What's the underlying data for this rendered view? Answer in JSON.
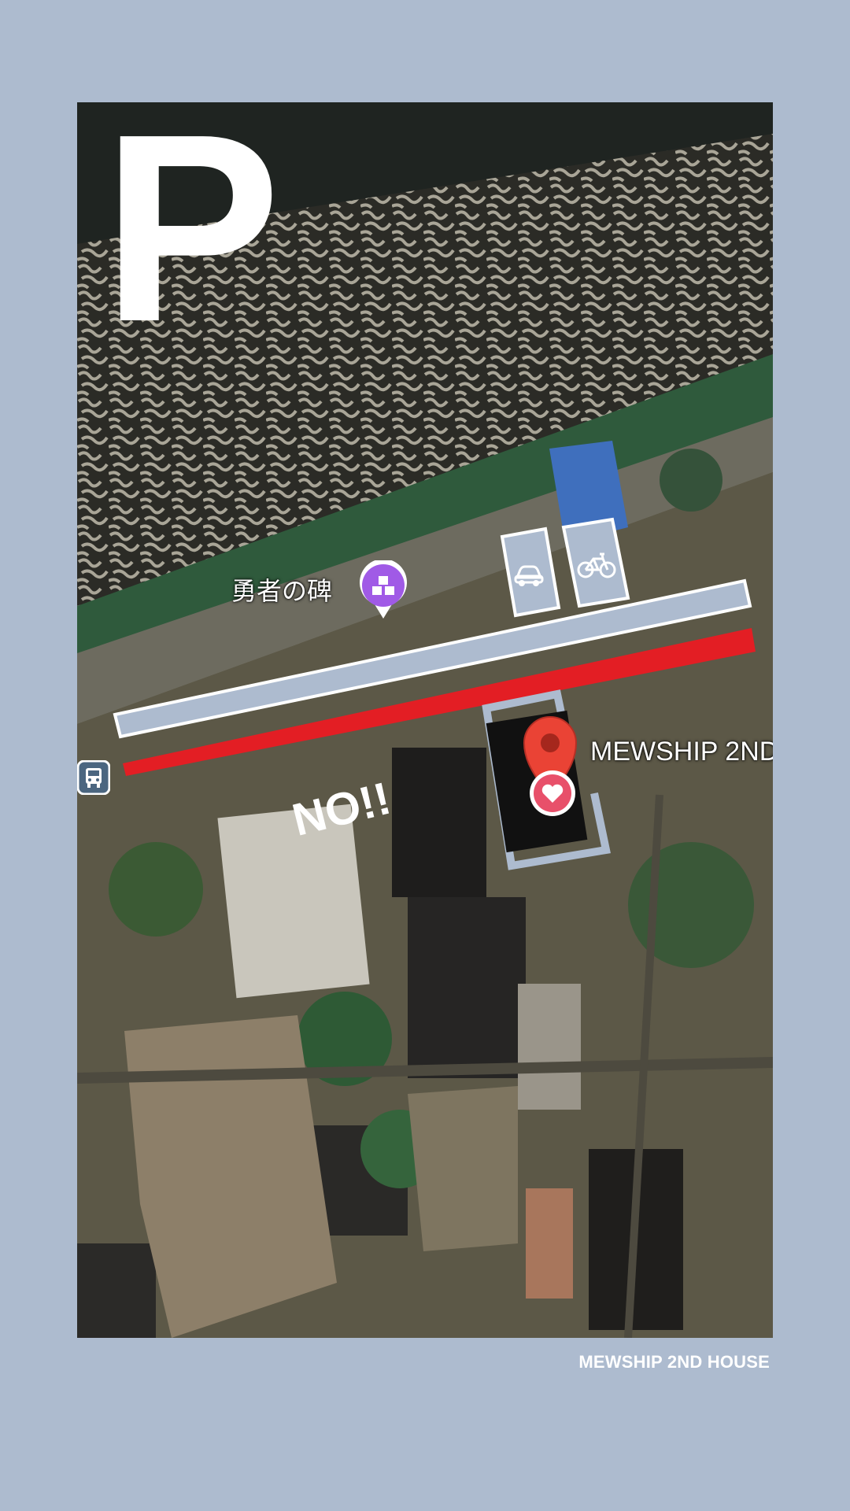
{
  "parking_letter": "P",
  "prohibited_label": "NO!!",
  "map": {
    "monument_label": "勇者の碑",
    "place_label": "MEWSHIP 2ND",
    "icons": [
      "parking-car-icon",
      "parking-bicycle-icon",
      "monument-pin-icon",
      "bus-stop-icon",
      "location-pin-icon",
      "heart-marker-icon"
    ]
  },
  "footer": {
    "title": "MEWSHIP 2ND HOUSE"
  },
  "colors": {
    "background": "#adbbcf",
    "parking_lane": "#adbbcf",
    "no_parking_lane": "#e31e24",
    "pin_red": "#ea4335",
    "monument_purple": "#a05ae6"
  }
}
